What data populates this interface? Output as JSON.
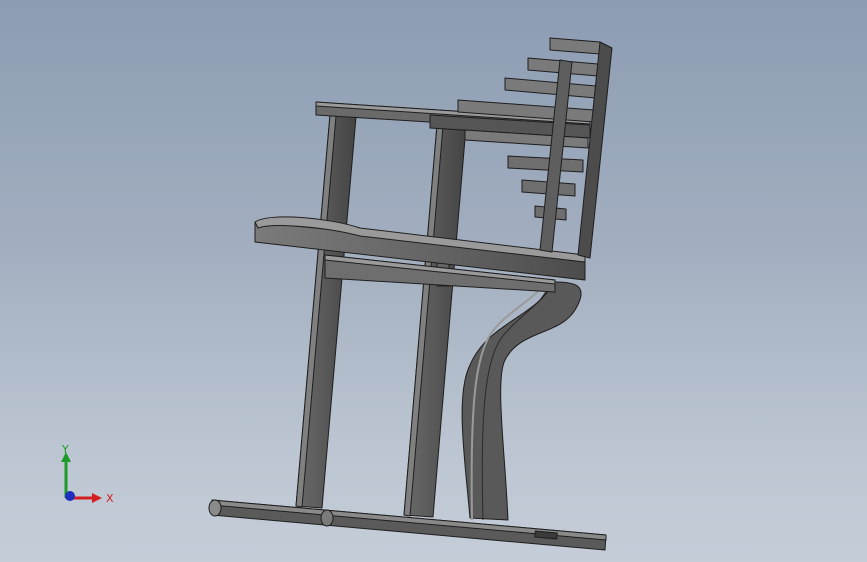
{
  "viewport": {
    "background_top": "#8c9cb3",
    "background_bottom": "#c4cdd8"
  },
  "model": {
    "part_fill": "#5c5c5c",
    "part_fill_light": "#8a8a8a",
    "part_fill_dark": "#3a3a3a",
    "edge_color": "#1e1e1e"
  },
  "triad": {
    "x_label": "X",
    "y_label": "Y",
    "x_color": "#d22020",
    "y_color": "#1e9a2a",
    "z_color": "#1f2fbf"
  }
}
